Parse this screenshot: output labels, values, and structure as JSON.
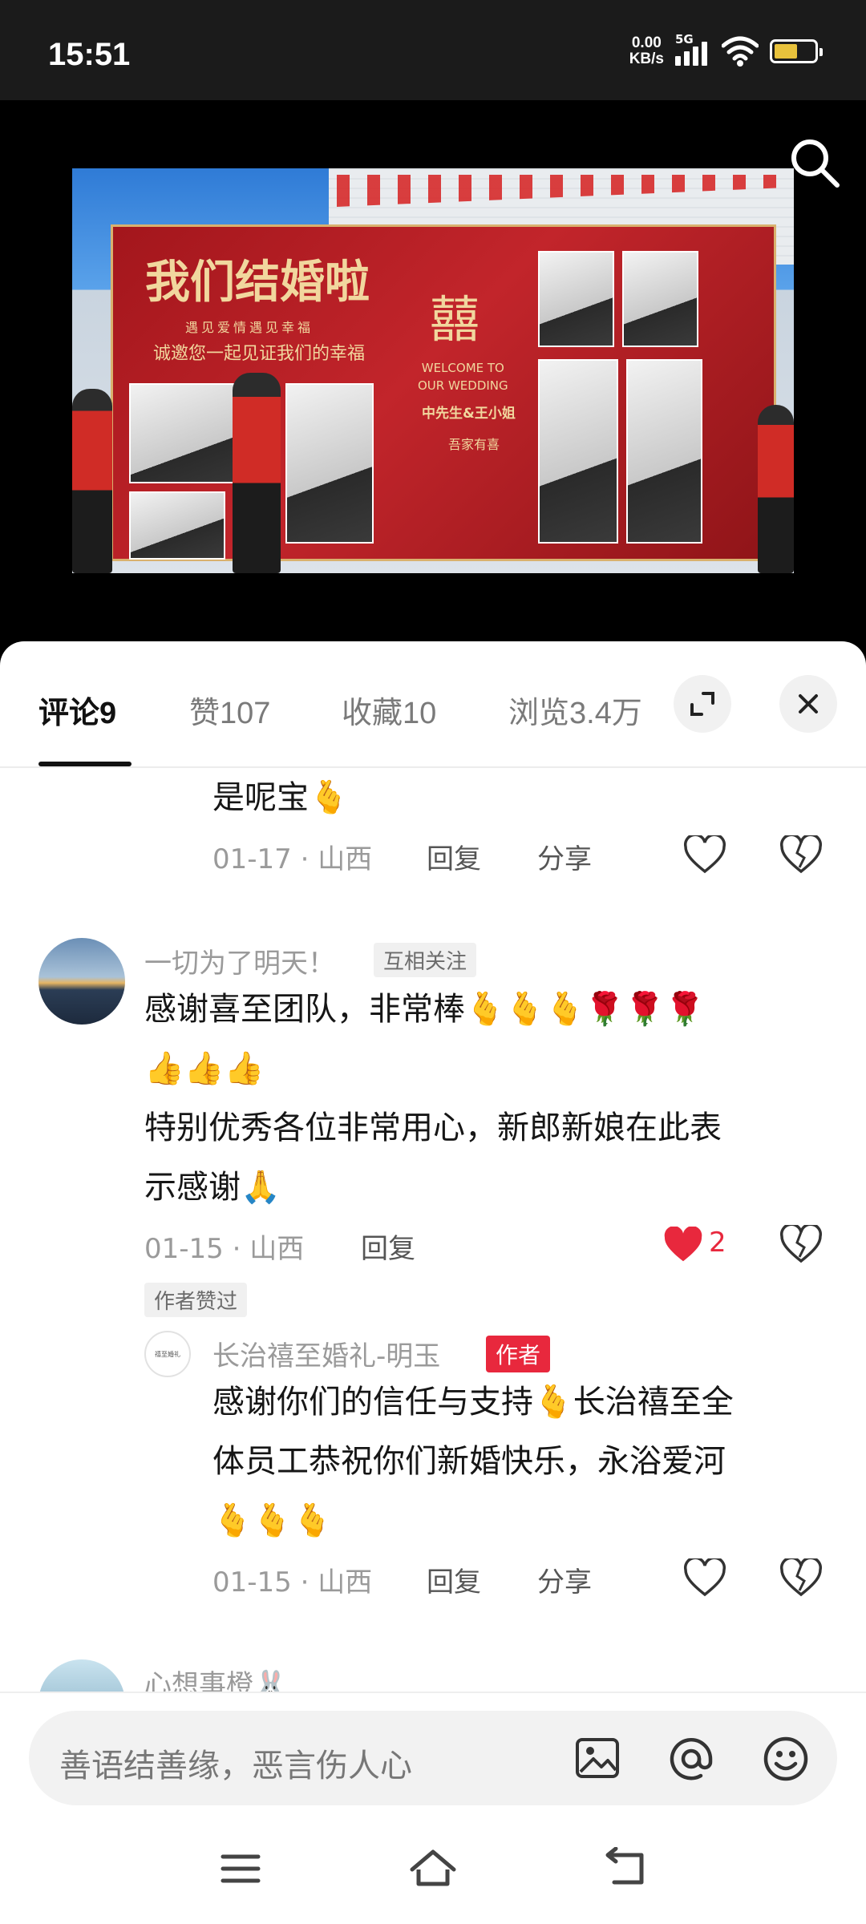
{
  "status_bar": {
    "time": "15:51",
    "net_speed_value": "0.00",
    "net_speed_unit": "KB/s",
    "network": "5G",
    "battery_level": 0.58
  },
  "video": {
    "board": {
      "title": "我们结婚啦",
      "subtitle": "遇见爱情遇见幸福",
      "invite": "诚邀您一起见证我们的幸福",
      "symbol": "囍",
      "welcome_1": "WELCOME TO",
      "welcome_2": "OUR WEDDING",
      "names": "中先生&王小姐",
      "home": "吾家有喜"
    }
  },
  "tabs": [
    {
      "label": "评论",
      "count": "9"
    },
    {
      "label": "赞",
      "count": "107"
    },
    {
      "label": "收藏",
      "count": "10"
    },
    {
      "label": "浏览",
      "count": "3.4万"
    }
  ],
  "comments": {
    "reply1": {
      "text": "是呢宝🫰",
      "date": "01-17",
      "location": "山西",
      "reply_label": "回复",
      "share_label": "分享"
    },
    "comment1": {
      "username": "一切为了明天！",
      "relation_tag": "互相关注",
      "line1": "感谢喜至团队，非常棒🫰🫰🫰🌹🌹🌹",
      "line2": "👍👍👍",
      "line3": "特别优秀各位非常用心，新郎新娘在此表",
      "line4": "示感谢🙏",
      "date": "01-15",
      "location": "山西",
      "reply_label": "回复",
      "likes": "2",
      "author_liked_tag": "作者赞过"
    },
    "reply2": {
      "username": "长治禧至婚礼-明玉",
      "author_tag": "作者",
      "avatar_text": "禧至婚礼",
      "line1": "感谢你们的信任与支持🫰长治禧至全",
      "line2": "体员工恭祝你们新婚快乐，永浴爱河",
      "line3": "🫰🫰🫰",
      "date": "01-15",
      "location": "山西",
      "reply_label": "回复",
      "share_label": "分享"
    },
    "next": {
      "username": "心想事橙🐰"
    }
  },
  "input": {
    "placeholder": "善语结善缘，恶言伤人心"
  },
  "colors": {
    "accent_red": "#e8283d",
    "board_red": "#b81e24",
    "board_gold": "#f1d79e"
  },
  "icons": [
    "search-icon",
    "expand-icon",
    "close-icon",
    "heart-icon",
    "dislike-icon",
    "image-icon",
    "at-icon",
    "emoji-icon",
    "menu-icon",
    "home-icon",
    "back-icon"
  ]
}
